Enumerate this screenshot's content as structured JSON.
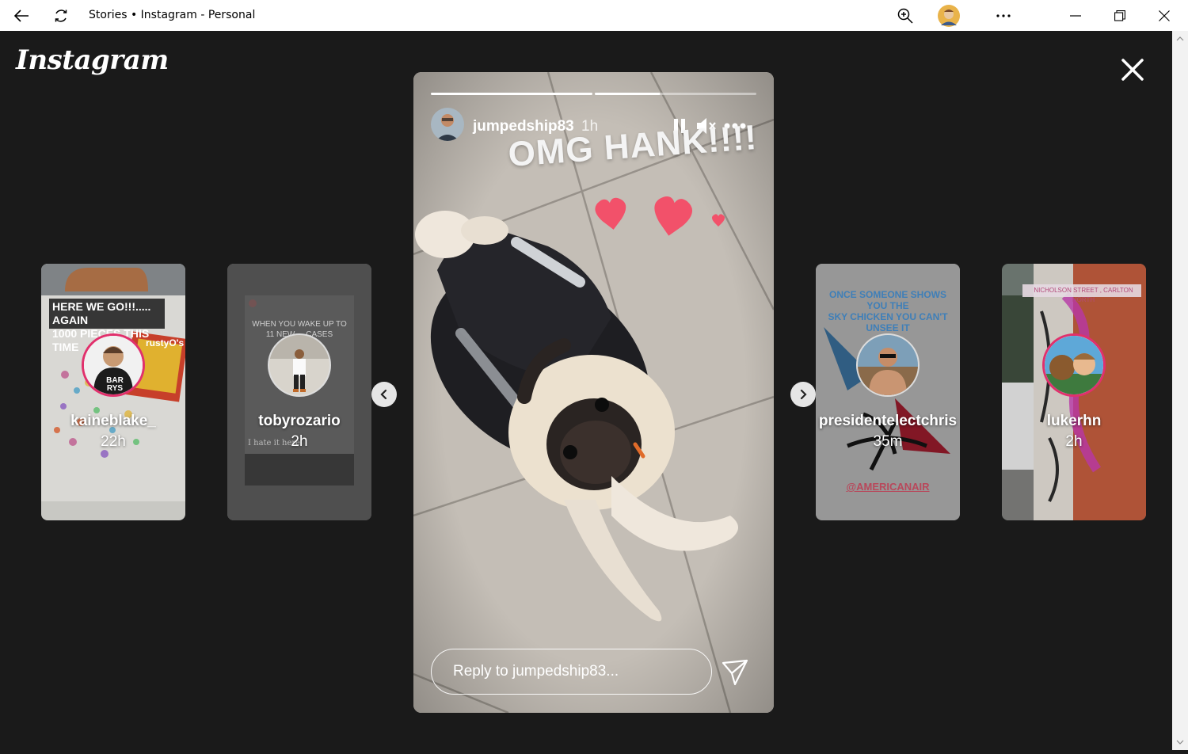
{
  "window": {
    "title": "Stories • Instagram - Personal"
  },
  "app": {
    "logo_text": "Instagram"
  },
  "story": {
    "username": "jumpedship83",
    "time": "1h",
    "overlay_text": "OMG HANK!!!!",
    "reply_placeholder": "Reply to jumpedship83...",
    "progress": [
      1.0,
      0.4
    ]
  },
  "thumbnails": [
    {
      "username": "kaineblake_",
      "time": "22h",
      "caption": "HERE WE GO!!!..... AGAIN\n1000 PIECES THIS TIME",
      "badge": "BAR\nRYS",
      "box_label": "rustyO's"
    },
    {
      "username": "tobyrozario",
      "time": "2h",
      "caption": "WHEN YOU WAKE UP TO\n11 NEW ... CASES",
      "footnote": "I hate it here"
    },
    {
      "username": "presidentelectchris",
      "time": "35m",
      "caption": "ONCE SOMEONE SHOWS YOU THE\nSKY CHICKEN YOU CAN'T UNSEE IT",
      "tag": "@AMERICANAIR"
    },
    {
      "username": "lukerhn",
      "time": "2h",
      "location": "NICHOLSON STREET , CARLTON NORTH"
    }
  ],
  "colors": {
    "background": "#1a1a1a",
    "heart": "#f2516a",
    "ring": "#e1306c"
  }
}
